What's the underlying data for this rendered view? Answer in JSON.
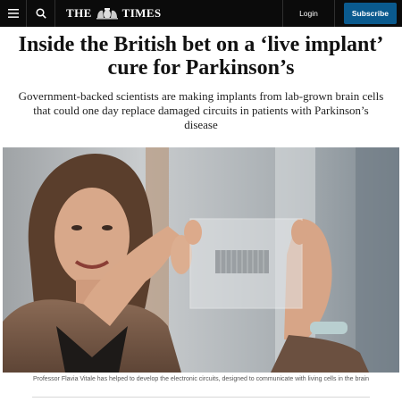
{
  "header": {
    "masthead": [
      "THE",
      "TIMES"
    ],
    "login_label": "Login",
    "subscribe_label": "Subscribe"
  },
  "icons": {
    "menu": "menu-icon",
    "search": "search-icon",
    "crest": "royal-crest-icon"
  },
  "colors": {
    "topbar": "#0b0b0b",
    "subscribe": "#0a5a8e"
  },
  "article": {
    "headline": "Inside the British bet on a ‘live implant’ cure for Parkinson’s",
    "standfirst": "Government-backed scientists are making implants from lab-grown brain cells that could one day replace damaged circuits in patients with Parkinson’s disease",
    "caption": "Professor Flavia Vitale has helped to develop the electronic circuits, designed to communicate with living cells in the brain"
  }
}
